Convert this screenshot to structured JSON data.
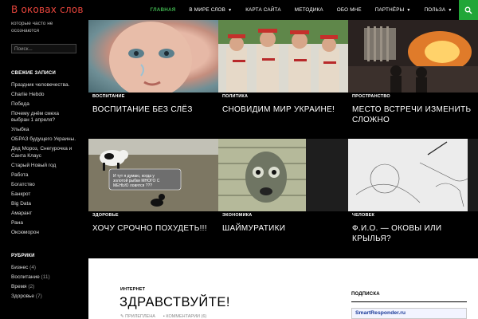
{
  "site": {
    "title": "В оковах слов",
    "tagline": "которые часто не осознаются"
  },
  "nav": {
    "items": [
      {
        "label": "Главная",
        "active": true,
        "caret": false
      },
      {
        "label": "В мире слов",
        "active": false,
        "caret": true
      },
      {
        "label": "Карта сайта",
        "active": false,
        "caret": false
      },
      {
        "label": "Методика",
        "active": false,
        "caret": false
      },
      {
        "label": "Обо мне",
        "active": false,
        "caret": false
      },
      {
        "label": "Партнёры",
        "active": false,
        "caret": true
      },
      {
        "label": "Польза",
        "active": false,
        "caret": true
      }
    ],
    "search_icon": "search-icon"
  },
  "sidebar": {
    "search_placeholder": "Поиск...",
    "recent_title": "Свежие записи",
    "recent": [
      "Праздник человечества.",
      "Charlie Hebdo",
      "Победа",
      "Почему днём смеха выбран 1 апреля?",
      "Улыбка",
      "ОБРАЗ будущего Украины.",
      "Дед Мороз, Снегурочка и Санта Клаус",
      "Старый Новый год",
      "Работа",
      "Богатство",
      "Банкрот",
      "Big Data",
      "Амарант",
      "Рана",
      "Оксюморон"
    ],
    "rubrics_title": "Рубрики",
    "rubrics": [
      {
        "name": "Бизнес",
        "count": "(4)"
      },
      {
        "name": "Воспитание",
        "count": "(11)"
      },
      {
        "name": "Время",
        "count": "(2)"
      },
      {
        "name": "Здоровье",
        "count": "(7)"
      }
    ]
  },
  "grid": {
    "cards": [
      {
        "category": "Воспитание",
        "title": "Воспитание без слёз"
      },
      {
        "category": "Политика",
        "title": "Сновидим мир Украине!"
      },
      {
        "category": "Пространство",
        "title": "Место встречи изменить сложно"
      },
      {
        "category": "Здоровье",
        "title": "Хочу срочно похудеть!!!"
      },
      {
        "category": "Экономика",
        "title": "Шаймуратики"
      },
      {
        "category": "Человек",
        "title": "Ф.И.О. — оковы или крылья?"
      }
    ],
    "speech_bubble": "И тут я думаю, когда у золотой рыбки МНОГО С МЕНЬЮ ловятся ???"
  },
  "main": {
    "post_category": "Интернет",
    "post_title": "Здравствуйте!",
    "meta": [
      "Прилеплена",
      "Комментарии (6)"
    ],
    "widget_title": "Подписка",
    "widget_text": "SmartResponder.ru"
  },
  "colors": {
    "accent_green": "#21a638",
    "title_red": "#e8453c",
    "nav_active": "#3fb34f"
  }
}
